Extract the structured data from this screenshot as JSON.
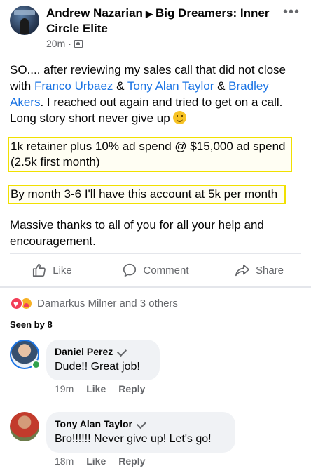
{
  "post": {
    "author": "Andrew Nazarian",
    "group": "Big Dreamers: Inner Circle Elite",
    "time": "20m",
    "separator": "·",
    "more_label": "•••",
    "body_part1": "SO.... after reviewing my sales call that did not close with ",
    "mention1": "Franco Urbaez",
    "amp1": " & ",
    "mention2": "Tony Alan Taylor",
    "amp2": " & ",
    "mention3": "Bradley Akers",
    "body_part2": ". I reached out again and tried to get on a call. Long story short never give up ",
    "highlight1": "1k retainer plus 10% ad spend @ $15,000 ad spend (2.5k first month)",
    "highlight2": "By month 3-6 I'll have this account at 5k per month",
    "closing": "Massive thanks to all of you for all your help and encouragement."
  },
  "actions": {
    "like": "Like",
    "comment": "Comment",
    "share": "Share"
  },
  "reactions": {
    "summary": "Damarkus Milner and 3 others"
  },
  "seen": "Seen by 8",
  "comments": [
    {
      "author": "Daniel Perez",
      "text": "Dude!! Great job!",
      "time": "19m",
      "like": "Like",
      "reply": "Reply"
    },
    {
      "author": "Tony Alan Taylor",
      "text": "Bro!!!!!! Never give up! Let's go!",
      "time": "18m",
      "like": "Like",
      "reply": "Reply"
    }
  ],
  "colors": {
    "link": "#1b74e4",
    "highlight_border": "#f1e000",
    "online": "#31a24c",
    "heart": "#f33e58"
  },
  "icons": [
    "avatar",
    "audience-icon",
    "more-icon",
    "like-icon",
    "comment-icon",
    "share-icon",
    "heart-reaction-icon",
    "care-reaction-icon",
    "top-fan-badge-icon",
    "smiley-emoji-icon"
  ]
}
